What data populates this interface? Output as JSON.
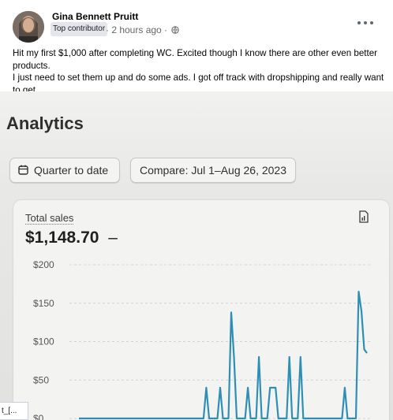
{
  "post": {
    "author": "Gina Bennett Pruitt",
    "badge": "Top contributor",
    "time": "· 2 hours ago ·",
    "text": "Hit my first $1,000 after completing WC.  Excited though I know there are other even better products.\nI just need to set them up and do some ads.  I got off track with dropshipping and really want to get\nmore POD products set up.  But, I have a ton of knowledge on what to do next!"
  },
  "analytics": {
    "title": "Analytics",
    "date_range": "Quarter to date",
    "compare": "Compare: Jul 1–Aug 26, 2023",
    "total_sales_label": "Total sales",
    "total_sales_value": "$1,148.70",
    "total_sales_dash": "–"
  },
  "overlay_tag": "t_[...",
  "chart_data": {
    "type": "line",
    "title": "",
    "ylabel": "",
    "xlabel": "",
    "y_ticks": [
      "$200",
      "$150",
      "$100",
      "$50",
      "$0"
    ],
    "y_tick_values": [
      200,
      150,
      100,
      50,
      0
    ],
    "ylim": [
      0,
      200
    ],
    "grid": true,
    "color": "#2e8fb5",
    "series": [
      {
        "values": [
          0,
          0,
          0,
          0,
          0,
          0,
          0,
          0,
          0,
          0,
          0,
          0,
          0,
          0,
          0,
          0,
          0,
          0,
          0,
          0,
          0,
          0,
          0,
          0,
          0,
          0,
          0,
          0,
          0,
          0,
          0,
          0,
          0,
          0,
          0,
          0,
          0,
          0,
          0,
          0,
          0,
          0,
          0,
          0,
          0,
          0,
          40,
          0,
          0,
          0,
          0,
          40,
          0,
          0,
          0,
          138,
          80,
          0,
          0,
          0,
          0,
          40,
          0,
          0,
          0,
          80,
          0,
          0,
          0,
          40,
          40,
          40,
          0,
          0,
          0,
          0,
          80,
          0,
          0,
          0,
          80,
          0,
          0,
          0,
          0,
          0,
          0,
          0,
          0,
          0,
          0,
          0,
          0,
          0,
          0,
          0,
          40,
          0,
          0,
          0,
          0,
          165,
          140,
          90,
          85
        ]
      }
    ]
  }
}
